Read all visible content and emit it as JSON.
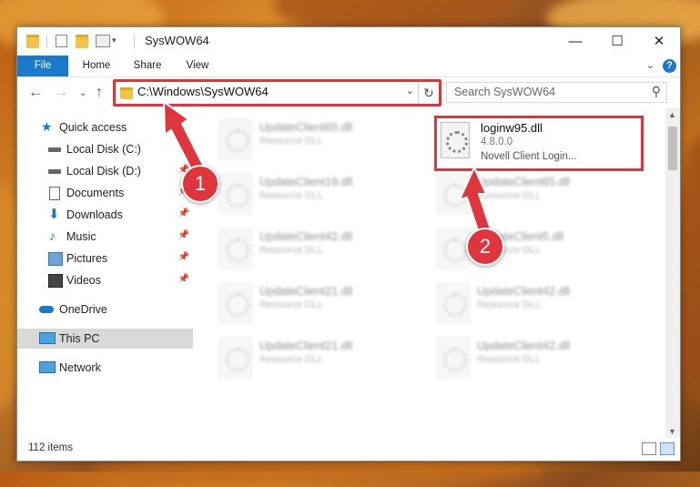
{
  "window": {
    "title": "SysWOW64",
    "controls": {
      "minimize": "—",
      "maximize": "☐",
      "close": "✕"
    }
  },
  "ribbon": {
    "tabs": [
      "File",
      "Home",
      "Share",
      "View"
    ],
    "help": "?"
  },
  "navigation": {
    "address_path": "C:\\Windows\\SysWOW64",
    "search_placeholder": "Search SysWOW64"
  },
  "sidebar": {
    "items": [
      {
        "label": "Quick access",
        "icon": "star-icon"
      },
      {
        "label": "Local Disk (C:)",
        "icon": "drive-icon"
      },
      {
        "label": "Local Disk (D:)",
        "icon": "drive-icon"
      },
      {
        "label": "Documents",
        "icon": "documents-icon"
      },
      {
        "label": "Downloads",
        "icon": "download-icon"
      },
      {
        "label": "Music",
        "icon": "music-icon"
      },
      {
        "label": "Pictures",
        "icon": "pictures-icon"
      },
      {
        "label": "Videos",
        "icon": "videos-icon"
      },
      {
        "label": "OneDrive",
        "icon": "cloud-icon"
      },
      {
        "label": "This PC",
        "icon": "computer-icon"
      },
      {
        "label": "Network",
        "icon": "network-icon"
      }
    ]
  },
  "files": {
    "left_column": [
      {
        "name": "UpdateClient65.dll",
        "type": "Resource DLL"
      },
      {
        "name": "UpdateClient19.dll",
        "type": "Resource DLL"
      },
      {
        "name": "UpdateClient42.dll",
        "type": "Resource DLL"
      },
      {
        "name": "UpdateClient21.dll",
        "type": "Resource DLL"
      },
      {
        "name": "UpdateClient21.dll",
        "type": "Resource DLL"
      }
    ],
    "right_column": [
      {
        "name": "UpdateClient65.dll",
        "type": "Resource DLL"
      },
      {
        "name": "UpdateClient5.dll",
        "type": "Resource DLL"
      },
      {
        "name": "UpdateClient42.dll",
        "type": "Resource DLL"
      },
      {
        "name": "UpdateClient42.dll",
        "type": "Resource DLL"
      }
    ],
    "highlighted": {
      "name": "loginw95.dll",
      "version": "4.8.0.0",
      "description": "Novell Client Login..."
    }
  },
  "status": {
    "item_count": "112 items"
  },
  "annotations": {
    "step1": "1",
    "step2": "2",
    "color": "#e0353d"
  }
}
